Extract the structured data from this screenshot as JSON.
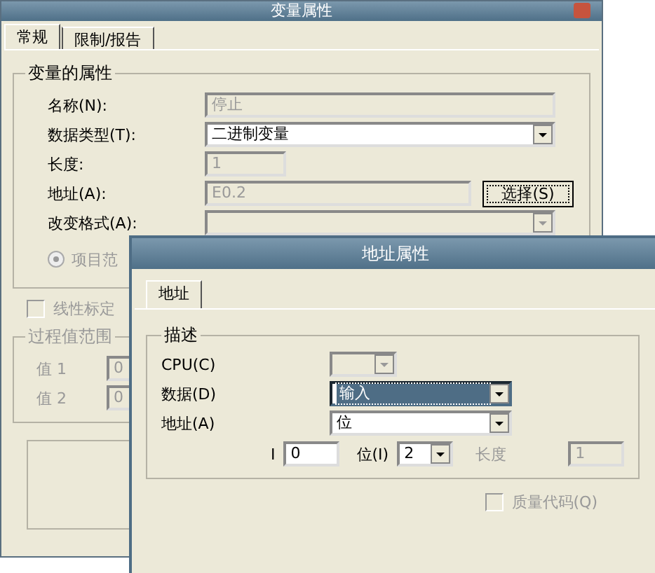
{
  "main_window": {
    "title": "变量属性",
    "tabs": [
      {
        "label": "常规",
        "selected": true
      },
      {
        "label": "限制/报告",
        "selected": false
      }
    ],
    "properties_group": {
      "title": "变量的属性",
      "fields": [
        {
          "label": "名称(N):",
          "kind": "text",
          "value": "停止",
          "disabled": true
        },
        {
          "label": "数据类型(T):",
          "kind": "combo",
          "value": "二进制变量",
          "disabled": false
        },
        {
          "label": "长度:",
          "kind": "short",
          "value": "1",
          "disabled": true
        },
        {
          "label": "地址(A):",
          "kind": "address",
          "value": "E0.2",
          "disabled": true,
          "button": "选择(S)"
        },
        {
          "label": "改变格式(A):",
          "kind": "combo",
          "disabled": true
        }
      ],
      "radio": {
        "label": "项目范",
        "selected": true,
        "disabled": true
      }
    },
    "linear_scaling": {
      "label": "线性标定",
      "checked": false,
      "disabled": true
    },
    "process_range": {
      "title": "过程值范围",
      "values": [
        {
          "label": "值 1",
          "value": "0"
        },
        {
          "label": "值 2",
          "value": "0"
        }
      ]
    }
  },
  "address_dialog": {
    "title": "地址属性",
    "tabs": [
      {
        "label": "地址",
        "selected": true
      }
    ],
    "group_title": "描述",
    "fields": [
      {
        "label": "CPU(C)",
        "kind": "combo",
        "disabled": true
      },
      {
        "label": "数据(D)",
        "kind": "combo",
        "value": "输入",
        "disabled": false,
        "highlighted": true
      },
      {
        "label": "地址(A)",
        "kind": "combo",
        "value": "位",
        "disabled": false
      }
    ],
    "bit_row": {
      "prefix": "I",
      "byte_value": "0",
      "bit_label": "位(I)",
      "bit_value": "2",
      "length_label": "长度",
      "length_value": "1"
    },
    "quality_code": {
      "label": "质量代码(Q)",
      "checked": false,
      "disabled": true
    }
  }
}
